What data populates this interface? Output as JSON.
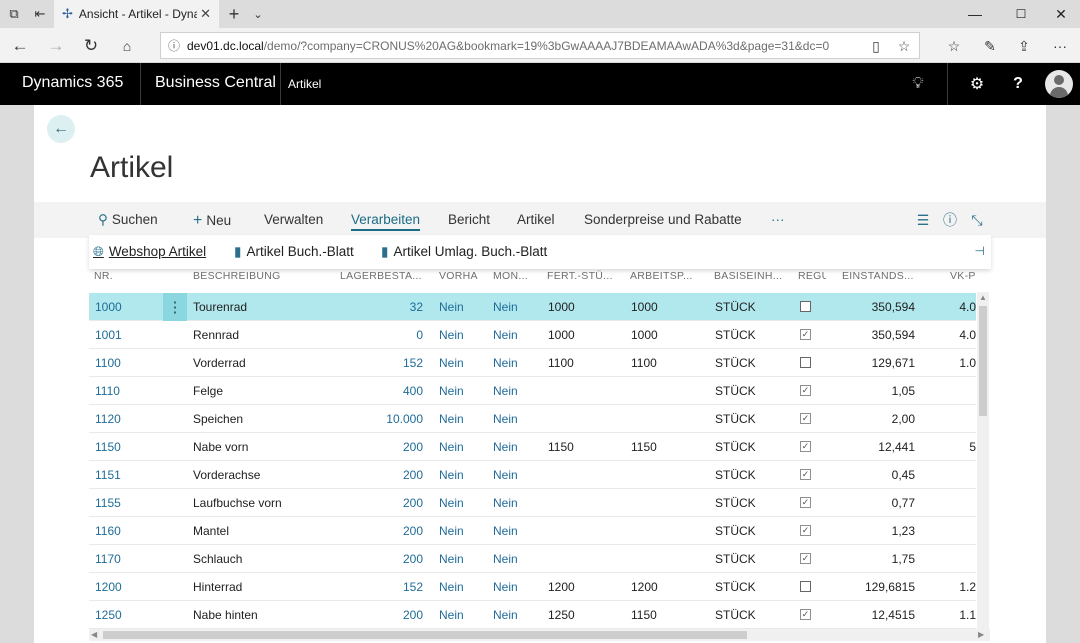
{
  "browser": {
    "tab_title": "Ansicht - Artikel - Dynam",
    "url_host": "dev01.dc.local",
    "url_path": "/demo/?company=CRONUS%20AG&bookmark=19%3bGwAAAAJ7BDEAMAAwADA%3d&page=31&dc=0"
  },
  "bc_header": {
    "product": "Dynamics 365",
    "app": "Business Central",
    "page": "Artikel"
  },
  "page": {
    "title": "Artikel"
  },
  "actions": {
    "search": "Suchen",
    "new": "Neu",
    "manage": "Verwalten",
    "process": "Verarbeiten",
    "report": "Bericht",
    "item": "Artikel",
    "prices": "Sonderpreise und Rabatte",
    "more": "···"
  },
  "subactions": {
    "webshop": "Webshop Artikel",
    "journal": "Artikel Buch.-Blatt",
    "reclass": "Artikel Umlag. Buch.-Blatt"
  },
  "columns": {
    "no": "NR.",
    "desc": "BESCHREIBUNG",
    "stock": "LAGERBESTA...",
    "vorha": "VORHA",
    "mon": "MON...",
    "fert": "FERT.-STÜ...",
    "arbeit": "ARBEITSP...",
    "unit": "BASISEINH...",
    "regu": "REGU",
    "cost": "EINSTANDS...",
    "price": "VK-PREI"
  },
  "rows": [
    {
      "no": "1000",
      "desc": "Tourenrad",
      "stock": "32",
      "vorha": "Nein",
      "mon": "Nein",
      "fert": "1000",
      "arbeit": "1000",
      "unit": "STÜCK",
      "regu": false,
      "cost": "350,594",
      "price": "4.0"
    },
    {
      "no": "1001",
      "desc": "Rennrad",
      "stock": "0",
      "vorha": "Nein",
      "mon": "Nein",
      "fert": "1000",
      "arbeit": "1000",
      "unit": "STÜCK",
      "regu": true,
      "cost": "350,594",
      "price": "4.0"
    },
    {
      "no": "1100",
      "desc": "Vorderrad",
      "stock": "152",
      "vorha": "Nein",
      "mon": "Nein",
      "fert": "1100",
      "arbeit": "1100",
      "unit": "STÜCK",
      "regu": false,
      "cost": "129,671",
      "price": "1.0"
    },
    {
      "no": "1110",
      "desc": "Felge",
      "stock": "400",
      "vorha": "Nein",
      "mon": "Nein",
      "fert": "",
      "arbeit": "",
      "unit": "STÜCK",
      "regu": true,
      "cost": "1,05",
      "price": ""
    },
    {
      "no": "1120",
      "desc": "Speichen",
      "stock": "10.000",
      "vorha": "Nein",
      "mon": "Nein",
      "fert": "",
      "arbeit": "",
      "unit": "STÜCK",
      "regu": true,
      "cost": "2,00",
      "price": ""
    },
    {
      "no": "1150",
      "desc": "Nabe vorn",
      "stock": "200",
      "vorha": "Nein",
      "mon": "Nein",
      "fert": "1150",
      "arbeit": "1150",
      "unit": "STÜCK",
      "regu": true,
      "cost": "12,441",
      "price": "5"
    },
    {
      "no": "1151",
      "desc": "Vorderachse",
      "stock": "200",
      "vorha": "Nein",
      "mon": "Nein",
      "fert": "",
      "arbeit": "",
      "unit": "STÜCK",
      "regu": true,
      "cost": "0,45",
      "price": ""
    },
    {
      "no": "1155",
      "desc": "Laufbuchse vorn",
      "stock": "200",
      "vorha": "Nein",
      "mon": "Nein",
      "fert": "",
      "arbeit": "",
      "unit": "STÜCK",
      "regu": true,
      "cost": "0,77",
      "price": ""
    },
    {
      "no": "1160",
      "desc": "Mantel",
      "stock": "200",
      "vorha": "Nein",
      "mon": "Nein",
      "fert": "",
      "arbeit": "",
      "unit": "STÜCK",
      "regu": true,
      "cost": "1,23",
      "price": ""
    },
    {
      "no": "1170",
      "desc": "Schlauch",
      "stock": "200",
      "vorha": "Nein",
      "mon": "Nein",
      "fert": "",
      "arbeit": "",
      "unit": "STÜCK",
      "regu": true,
      "cost": "1,75",
      "price": ""
    },
    {
      "no": "1200",
      "desc": "Hinterrad",
      "stock": "152",
      "vorha": "Nein",
      "mon": "Nein",
      "fert": "1200",
      "arbeit": "1200",
      "unit": "STÜCK",
      "regu": false,
      "cost": "129,6815",
      "price": "1.2"
    },
    {
      "no": "1250",
      "desc": "Nabe hinten",
      "stock": "200",
      "vorha": "Nein",
      "mon": "Nein",
      "fert": "1250",
      "arbeit": "1150",
      "unit": "STÜCK",
      "regu": true,
      "cost": "12,4515",
      "price": "1.1"
    }
  ],
  "selected_row": 0,
  "colors": {
    "accent": "#1f6c98",
    "selected_row": "#b1e8ee",
    "header_bg": "#000000"
  }
}
